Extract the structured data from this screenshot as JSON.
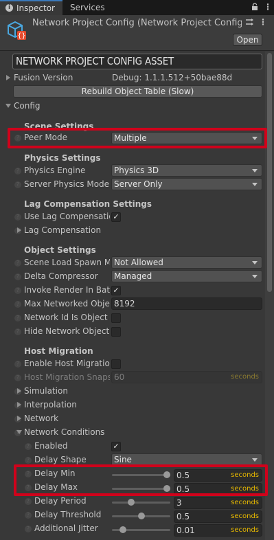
{
  "tabs": {
    "inspector": "Inspector",
    "services": "Services"
  },
  "header": {
    "title": "Network Project Config (Network Project Config",
    "open_label": "Open"
  },
  "asset_name": "NETWORK PROJECT CONFIG ASSET",
  "fusion_version": {
    "label": "Fusion Version",
    "value": "Debug: 1.1.1.512+50bae88d"
  },
  "rebuild_label": "Rebuild Object Table (Slow)",
  "config_label": "Config",
  "scene_settings": {
    "title": "Scene Settings",
    "peer_mode": {
      "label": "Peer Mode",
      "value": "Multiple"
    }
  },
  "physics_settings": {
    "title": "Physics Settings",
    "physics_engine": {
      "label": "Physics Engine",
      "value": "Physics 3D"
    },
    "server_physics_mode": {
      "label": "Server Physics Mode",
      "value": "Server Only"
    }
  },
  "lag_compensation_settings": {
    "title": "Lag Compensation Settings",
    "use_lag_compensation": {
      "label": "Use Lag Compensatio",
      "checked": true
    },
    "lag_compensation": "Lag Compensation"
  },
  "object_settings": {
    "title": "Object Settings",
    "scene_load_spawn": {
      "label": "Scene Load Spawn M",
      "value": "Not Allowed"
    },
    "delta_compressor": {
      "label": "Delta Compressor",
      "value": "Managed"
    },
    "invoke_render": {
      "label": "Invoke Render In Batc",
      "checked": true
    },
    "max_networked": {
      "label": "Max Networked Objec",
      "value": "8192"
    },
    "network_id_is_object": {
      "label": "Network Id Is Object N",
      "checked": false
    },
    "hide_network_object": {
      "label": "Hide Network Object I",
      "checked": false
    }
  },
  "host_migration": {
    "title": "Host Migration",
    "enable": {
      "label": "Enable Host Migration",
      "checked": false
    },
    "snapshot": {
      "label": "Host Migration Snapsh",
      "value": "60",
      "unit": "seconds"
    }
  },
  "collapsed": {
    "simulation": "Simulation",
    "interpolation": "Interpolation",
    "network": "Network"
  },
  "network_conditions": {
    "title": "Network Conditions",
    "enabled": {
      "label": "Enabled",
      "checked": true
    },
    "delay_shape": {
      "label": "Delay Shape",
      "value": "Sine"
    },
    "delay_min": {
      "label": "Delay Min",
      "value": "0.5",
      "unit": "seconds",
      "fraction": 1.0
    },
    "delay_max": {
      "label": "Delay Max",
      "value": "0.5",
      "unit": "seconds",
      "fraction": 1.0
    },
    "delay_period": {
      "label": "Delay Period",
      "value": "3",
      "unit": "seconds",
      "fraction": 0.3
    },
    "delay_threshold": {
      "label": "Delay Threshold",
      "value": "0.5",
      "unit": "seconds",
      "fraction": 0.5
    },
    "additional_jitter": {
      "label": "Additional Jitter",
      "value": "0.01",
      "unit": "seconds",
      "fraction": 0.15
    }
  },
  "colors": {
    "highlight": "#d0021b",
    "accent": "#3a79bb",
    "unit": "#e6b800"
  }
}
